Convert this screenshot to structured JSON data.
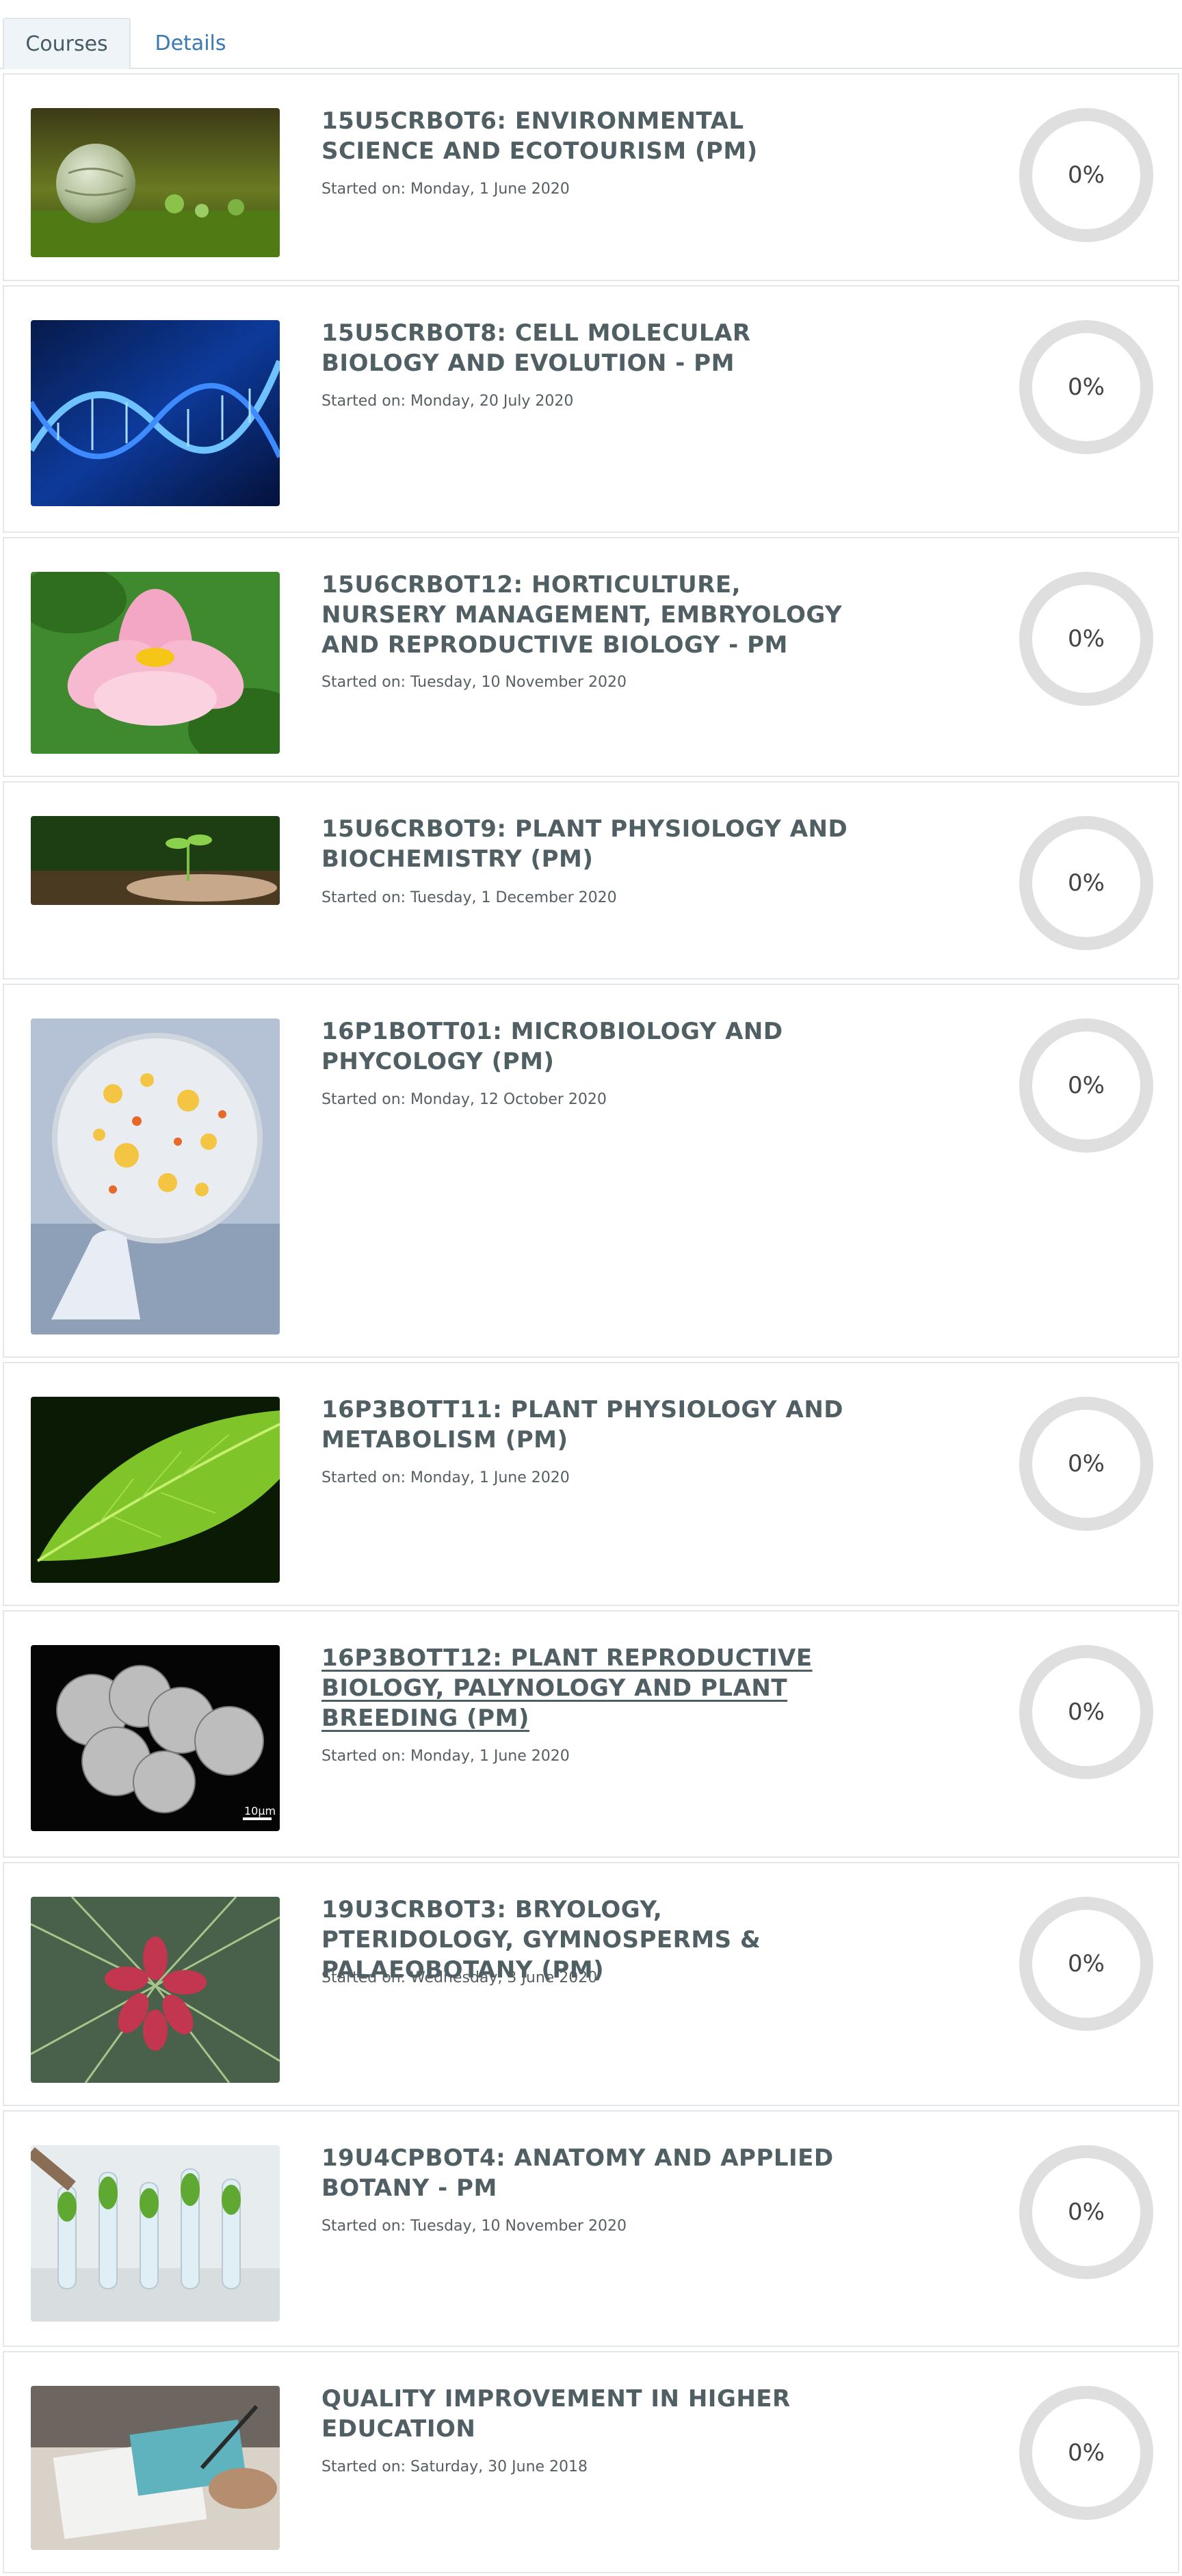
{
  "tabs": [
    {
      "label": "Courses",
      "active": true
    },
    {
      "label": "Details",
      "active": false
    }
  ],
  "courses": [
    {
      "title": "15U5CRBOT6: ENVIRONMENTAL SCIENCE AND ECOTOURISM (PM)",
      "started": "Started on: Monday, 1 June 2020",
      "progress": "0%",
      "image": "glass-globe-on-moss"
    },
    {
      "title": "15U5CRBOT8: CELL MOLECULAR BIOLOGY AND EVOLUTION - PM",
      "started": "Started on: Monday, 20 July 2020",
      "progress": "0%",
      "image": "blue-dna-helix"
    },
    {
      "title": "15U6CRBOT12: HORTICULTURE, NURSERY MANAGEMENT, EMBRYOLOGY AND REPRODUCTIVE BIOLOGY - PM",
      "started": "Started on: Tuesday, 10 November 2020",
      "progress": "0%",
      "image": "pink-lotus-flower"
    },
    {
      "title": "15U6CRBOT9: PLANT PHYSIOLOGY AND BIOCHEMISTRY (PM)",
      "started": "Started on: Tuesday, 1 December 2020",
      "progress": "0%",
      "image": "seedling-in-hands"
    },
    {
      "title": "16P1BOTT01: MICROBIOLOGY AND PHYCOLOGY (PM)",
      "started": "Started on: Monday, 12 October 2020",
      "progress": "0%",
      "image": "petri-dish-cultures"
    },
    {
      "title": "16P3BOTT11: PLANT PHYSIOLOGY AND METABOLISM (PM)",
      "started": "Started on: Monday, 1 June 2020",
      "progress": "0%",
      "image": "green-leaf"
    },
    {
      "title": "16P3BOTT12: PLANT REPRODUCTIVE BIOLOGY, PALYNOLOGY AND PLANT BREEDING (PM)",
      "started": "Started on: Monday, 1 June 2020",
      "progress": "0%",
      "image": "pollen-grains-micrograph",
      "scale_label": "10µm",
      "hovered": true
    },
    {
      "title": "19U3CRBOT3: BRYOLOGY, PTERIDOLOGY, GYMNOSPERMS & PALAEOBOTANY (PM)",
      "started": "Started on: Wednesday, 3 June 2020",
      "progress": "0%",
      "image": "pine-cone-flower"
    },
    {
      "title": "19U4CPBOT4: ANATOMY AND APPLIED BOTANY - PM",
      "started": "Started on: Tuesday, 10 November 2020",
      "progress": "0%",
      "image": "plant-test-tubes"
    },
    {
      "title": "QUALITY IMPROVEMENT IN HIGHER EDUCATION",
      "started": "Started on: Saturday, 30 June 2018",
      "progress": "0%",
      "image": "hands-with-pen-documents"
    }
  ]
}
